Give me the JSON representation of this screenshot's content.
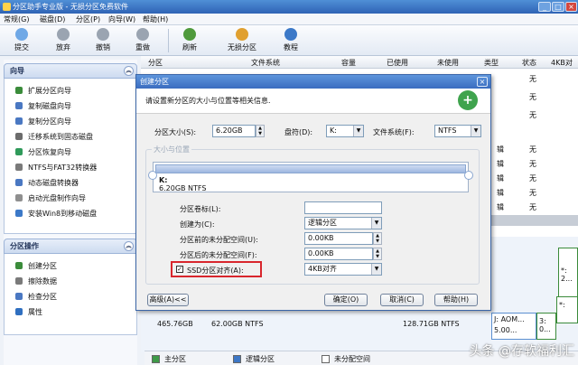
{
  "window": {
    "title": "分区助手专业版 - 无损分区免费软件",
    "min": "_",
    "max": "□",
    "close": "×"
  },
  "menu": [
    "常规(G)",
    "磁盘(D)",
    "分区(P)",
    "向导(W)",
    "帮助(H)"
  ],
  "toolbar": [
    "提交",
    "放弃",
    "撤销",
    "重做",
    "刷新",
    "无损分区",
    "教程"
  ],
  "sidebar": {
    "wizard_title": "向导",
    "wizard_items": [
      "扩展分区向导",
      "复制磁盘向导",
      "复制分区向导",
      "迁移系统到固态磁盘",
      "分区恢复向导",
      "NTFS与FAT32转换器",
      "动态磁盘转换器",
      "启动光盘制作向导",
      "安装Win8到移动磁盘"
    ],
    "ops_title": "分区操作",
    "ops_items": [
      "创建分区",
      "擦除数据",
      "检查分区",
      "属性"
    ]
  },
  "table": {
    "headers": [
      "分区",
      "文件系统",
      "容量",
      "已使用",
      "未使用",
      "类型",
      "状态",
      "4KB对"
    ],
    "right_col_a": [
      "辑",
      "辑",
      "辑",
      "辑",
      "辑",
      "辑",
      "辑",
      "辑",
      "辑"
    ],
    "right_col_b": [
      "无",
      "无",
      "无",
      "无",
      "无",
      "无",
      "无",
      "无",
      "无"
    ]
  },
  "disk_strip": {
    "c1": "465.76GB",
    "c2": "62.00GB NTFS",
    "c3": "128.71GB NTFS",
    "c4a": "J: AOM...",
    "c4b": "5.00...",
    "c5": "*: 2...",
    "c6": "3: 0...",
    "c7": "*:"
  },
  "legend": [
    "主分区",
    "逻辑分区",
    "未分配空间"
  ],
  "dialog": {
    "title": "创建分区",
    "close": "×",
    "message": "请设置新分区的大小与位置等相关信息.",
    "size_label": "分区大小(S):",
    "size_value": "6.20GB",
    "drive_label": "盘符(D):",
    "drive_value": "K:",
    "fs_label": "文件系统(F):",
    "fs_value": "NTFS",
    "group_label": "大小与位置",
    "part_name": "K:",
    "part_desc": "6.20GB NTFS",
    "vol_label": "分区卷标(L):",
    "vol_value": "",
    "create_as_label": "创建为(C):",
    "create_as_value": "逻辑分区",
    "before_label": "分区前的未分配空间(U):",
    "before_value": "0.00KB",
    "after_label": "分区后的未分配空间(F):",
    "after_value": "0.00KB",
    "ssd_label": "SSD分区对齐(A):",
    "ssd_value": "4KB对齐",
    "advanced": "高级(A)<<",
    "ok": "确定(O)",
    "cancel": "取消(C)",
    "help": "帮助(H)"
  },
  "watermark": "头条 @存软福利汇"
}
